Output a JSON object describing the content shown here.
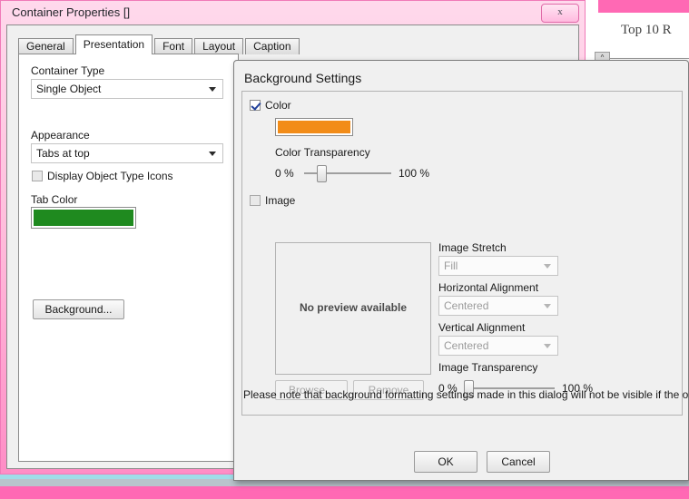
{
  "desktop": {
    "background_app": {
      "title": "Top 10 R",
      "collapse_icon": "^"
    }
  },
  "container_window": {
    "title": "Container Properties []",
    "close_label": "x",
    "tabs": [
      {
        "label": "General",
        "active": false
      },
      {
        "label": "Presentation",
        "active": true
      },
      {
        "label": "Font",
        "active": false
      },
      {
        "label": "Layout",
        "active": false
      },
      {
        "label": "Caption",
        "active": false
      }
    ],
    "presentation": {
      "container_type_label": "Container Type",
      "container_type_value": "Single Object",
      "appearance_label": "Appearance",
      "appearance_value": "Tabs at top",
      "display_icons_label": "Display Object Type Icons",
      "display_icons_checked": false,
      "tab_color_label": "Tab Color",
      "tab_color_value": "#1f8a1f",
      "background_button_label": "Background..."
    }
  },
  "background_dialog": {
    "heading": "Background Settings",
    "color": {
      "checkbox_label": "Color",
      "checked": true,
      "swatch_value": "#f28c18",
      "transparency_label": "Color Transparency",
      "transparency_min": "0 %",
      "transparency_max": "100 %",
      "transparency_percent": 20
    },
    "image": {
      "checkbox_label": "Image",
      "checked": false,
      "preview_text": "No preview available",
      "browse_label": "Browse...",
      "remove_label": "Remove",
      "stretch_label": "Image Stretch",
      "stretch_value": "Fill",
      "horizontal_alignment_label": "Horizontal Alignment",
      "horizontal_alignment_value": "Centered",
      "vertical_alignment_label": "Vertical Alignment",
      "vertical_alignment_value": "Centered",
      "transparency_label": "Image Transparency",
      "transparency_min": "0 %",
      "transparency_max": "100 %",
      "transparency_percent": 2
    },
    "note": "Please note that background formatting settings made in this dialog will not be visible if the overlying ce",
    "ok_label": "OK",
    "cancel_label": "Cancel"
  }
}
